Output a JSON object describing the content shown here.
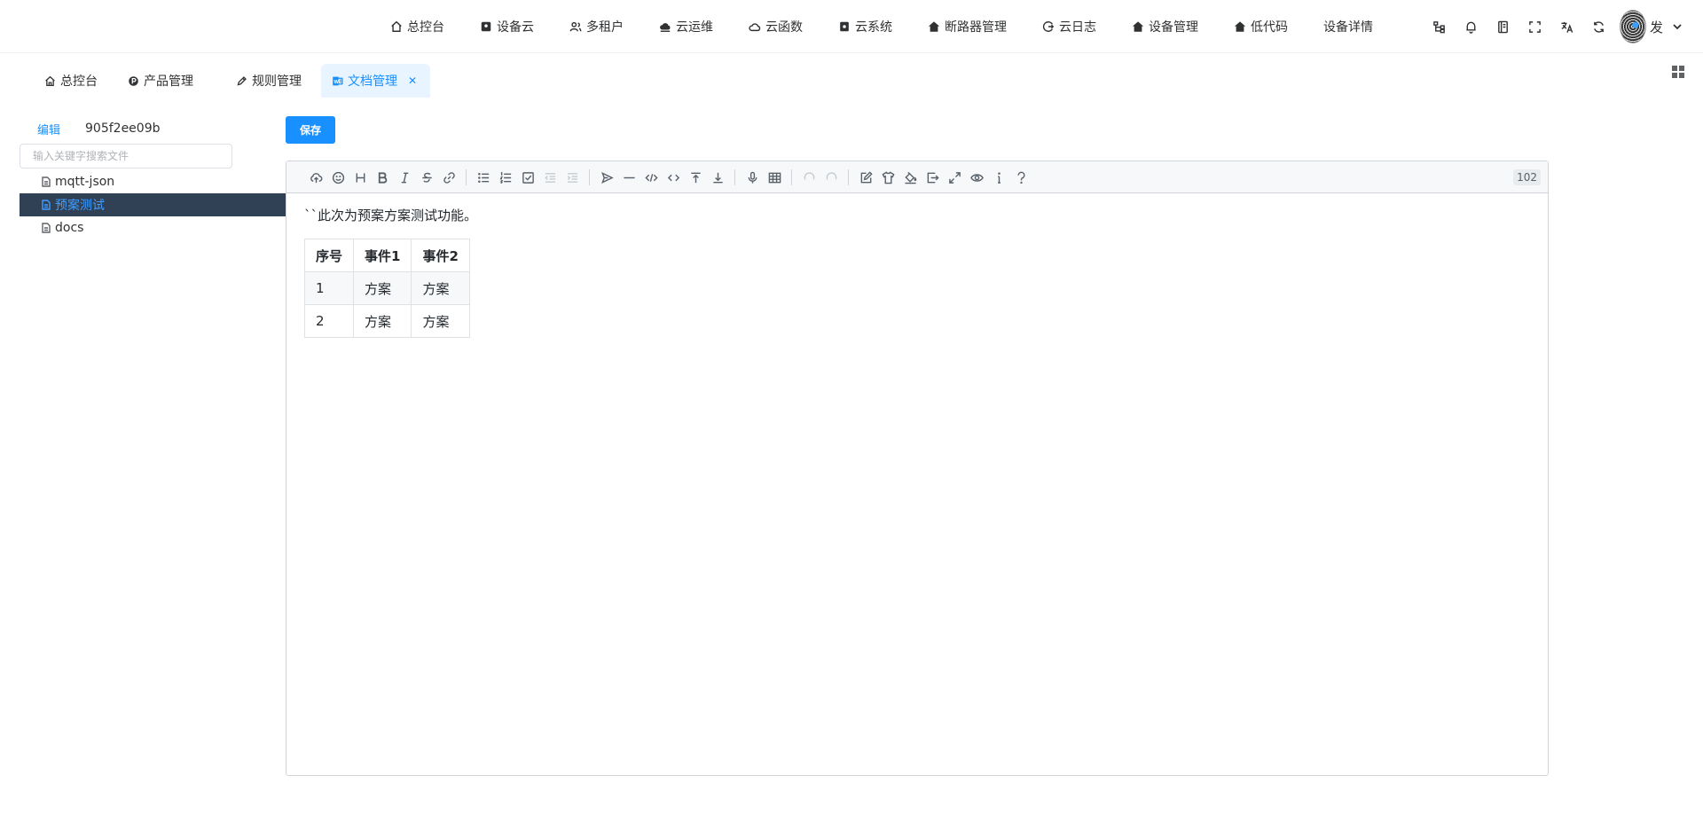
{
  "topnav": {
    "items": [
      {
        "label": "总控台",
        "icon": "home-icon"
      },
      {
        "label": "设备云",
        "icon": "device-icon"
      },
      {
        "label": "多租户",
        "icon": "users-icon"
      },
      {
        "label": "云运维",
        "icon": "cloud-ops-icon"
      },
      {
        "label": "云函数",
        "icon": "cloud-icon"
      },
      {
        "label": "云系统",
        "icon": "system-icon"
      },
      {
        "label": "断路器管理",
        "icon": "house-solid-icon"
      },
      {
        "label": "云日志",
        "icon": "log-icon"
      },
      {
        "label": "设备管理",
        "icon": "house-solid-icon"
      },
      {
        "label": "低代码",
        "icon": "house-solid-icon"
      },
      {
        "label": "设备详情",
        "icon": ""
      }
    ],
    "user_name": "发"
  },
  "tabs": [
    {
      "label": "总控台",
      "icon": "home-icon"
    },
    {
      "label": "产品管理",
      "icon": "product-icon"
    },
    {
      "label": "规则管理",
      "icon": "pen-icon"
    },
    {
      "label": "文档管理",
      "icon": "doc-icon",
      "active": true
    }
  ],
  "sidebar": {
    "edit_label": "编辑",
    "doc_id": "905f2ee09b",
    "search_placeholder": "输入关键字搜索文件",
    "files": [
      {
        "label": "mqtt-json"
      },
      {
        "label": "预案测试",
        "selected": true
      },
      {
        "label": "docs"
      }
    ]
  },
  "save_label": "保存",
  "editor": {
    "char_count": "102",
    "paragraph": "``此次为预案方案测试功能。",
    "table": {
      "headers": [
        "序号",
        "事件1",
        "事件2"
      ],
      "rows": [
        [
          "1",
          "方案",
          "方案"
        ],
        [
          "2",
          "方案",
          "方案"
        ]
      ]
    }
  },
  "colors": {
    "primary": "#1890ff",
    "tree_selected_bg": "#304156",
    "active_tab_bg": "#e8f4ff"
  }
}
